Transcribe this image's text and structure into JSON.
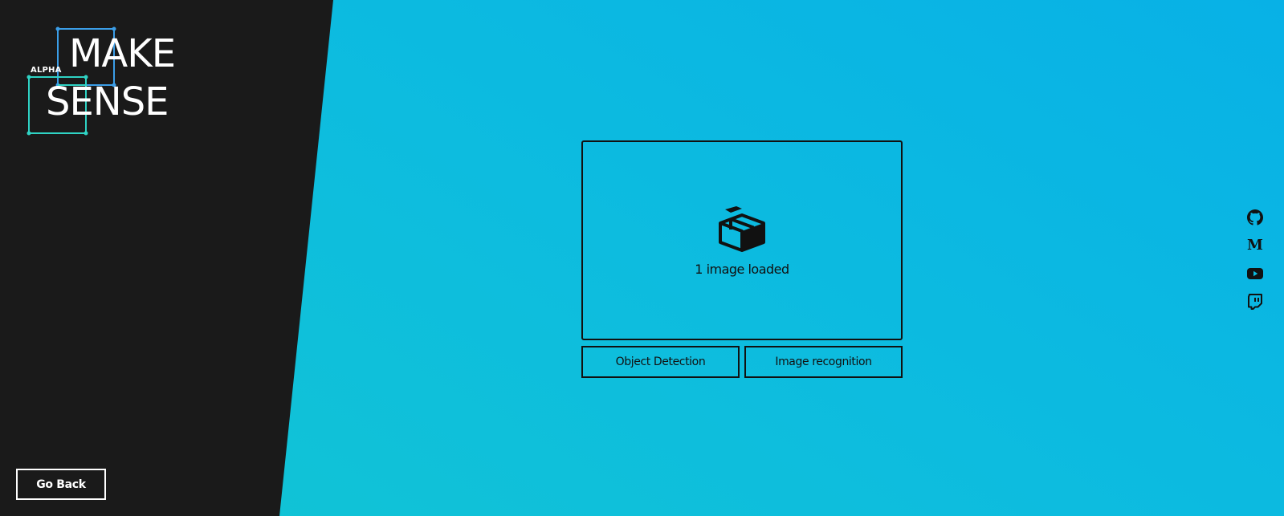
{
  "logo": {
    "tag": "ALPHA",
    "line1": "MAKE",
    "line2": "SENSE"
  },
  "left_panel": {
    "go_back_label": "Go Back"
  },
  "dropzone": {
    "icon": "box-icon",
    "status": "1 image loaded"
  },
  "actions": {
    "object_detection_label": "Object Detection",
    "image_recognition_label": "Image recognition"
  },
  "social": {
    "icons": [
      "github-icon",
      "medium-icon",
      "youtube-icon",
      "twitch-icon"
    ],
    "medium_glyph": "M"
  },
  "colors": {
    "background_gradient_start": "#08b1e6",
    "background_gradient_end": "#12c5d3",
    "panel": "#1a1a1a",
    "logo_blue": "#3b9ee8",
    "logo_teal": "#2fd3c4",
    "foreground": "#111111"
  }
}
